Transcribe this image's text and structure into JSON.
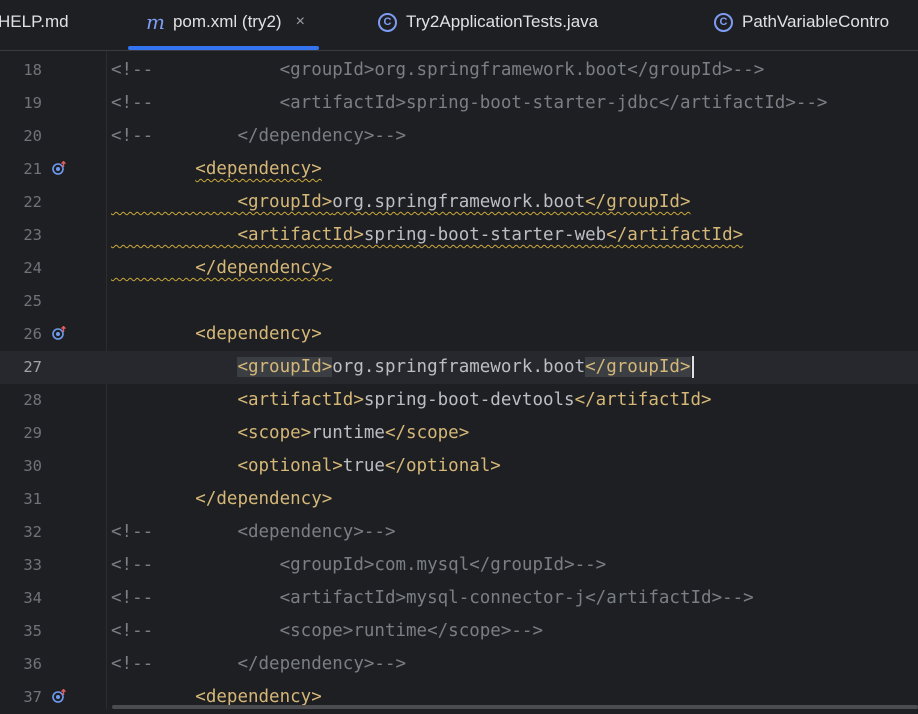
{
  "tabs": [
    {
      "label": "HELP.md",
      "icon": "markdown-icon",
      "active": false
    },
    {
      "label": "pom.xml (try2)",
      "icon": "maven-m-icon",
      "active": true,
      "closable": true
    },
    {
      "label": "Try2ApplicationTests.java",
      "icon": "class-c-icon",
      "active": false
    },
    {
      "label": "PathVariableContro",
      "icon": "class-c-icon",
      "active": false
    }
  ],
  "close_glyph": "×",
  "colors": {
    "background": "#1e1f22",
    "tag": "#d5b778",
    "comment": "#7a7e85",
    "text": "#bcbec4",
    "accent": "#3574f0",
    "warning_squiggle": "#c9a83c"
  },
  "editor": {
    "current_line": "27",
    "gutter_icon": "override-up-arrow-icon",
    "lines": [
      {
        "n": "18",
        "comment_prefix": "<!--",
        "indent": "            ",
        "content": "<groupId>org.springframework.boot</groupId>-->"
      },
      {
        "n": "19",
        "comment_prefix": "<!--",
        "indent": "            ",
        "content": "<artifactId>spring-boot-starter-jdbc</artifactId>-->"
      },
      {
        "n": "20",
        "comment_prefix": "<!--",
        "indent": "        ",
        "content": "</dependency>-->"
      },
      {
        "n": "21",
        "icon": true,
        "indent": "        ",
        "open": "<dependency>",
        "text": "",
        "close": ""
      },
      {
        "n": "22",
        "indent": "            ",
        "open": "<groupId>",
        "text": "org.springframework.boot",
        "close": "</groupId>"
      },
      {
        "n": "23",
        "indent": "            ",
        "open": "<artifactId>",
        "text": "spring-boot-starter-web",
        "close": "</artifactId>"
      },
      {
        "n": "24",
        "indent": "        ",
        "open": "</dependency>",
        "text": "",
        "close": ""
      },
      {
        "n": "25",
        "indent": "",
        "open": "",
        "text": "",
        "close": ""
      },
      {
        "n": "26",
        "icon": true,
        "indent": "        ",
        "open": "<dependency>",
        "text": "",
        "close": ""
      },
      {
        "n": "27",
        "indent": "            ",
        "open": "<groupId>",
        "text": "org.springframework.boot",
        "close": "</groupId>"
      },
      {
        "n": "28",
        "indent": "            ",
        "open": "<artifactId>",
        "text": "spring-boot-devtools",
        "close": "</artifactId>"
      },
      {
        "n": "29",
        "indent": "            ",
        "open": "<scope>",
        "text": "runtime",
        "close": "</scope>"
      },
      {
        "n": "30",
        "indent": "            ",
        "open": "<optional>",
        "text": "true",
        "close": "</optional>"
      },
      {
        "n": "31",
        "indent": "        ",
        "open": "</dependency>",
        "text": "",
        "close": ""
      },
      {
        "n": "32",
        "comment_prefix": "<!--",
        "indent": "        ",
        "content": "<dependency>-->"
      },
      {
        "n": "33",
        "comment_prefix": "<!--",
        "indent": "            ",
        "content": "<groupId>com.mysql</groupId>-->"
      },
      {
        "n": "34",
        "comment_prefix": "<!--",
        "indent": "            ",
        "content": "<artifactId>mysql-connector-j</artifactId>-->"
      },
      {
        "n": "35",
        "comment_prefix": "<!--",
        "indent": "            ",
        "content": "<scope>runtime</scope>-->"
      },
      {
        "n": "36",
        "comment_prefix": "<!--",
        "indent": "        ",
        "content": "</dependency>-->"
      },
      {
        "n": "37",
        "icon": true,
        "indent": "        ",
        "open": "<dependency>",
        "text": "",
        "close": ""
      }
    ]
  }
}
